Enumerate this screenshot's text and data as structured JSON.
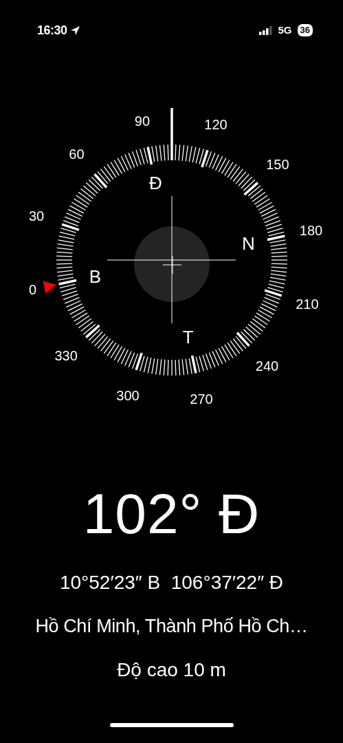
{
  "status_bar": {
    "time": "16:30",
    "network": "5G",
    "battery": "36"
  },
  "compass": {
    "degree_labels": [
      "0",
      "30",
      "60",
      "90",
      "120",
      "150",
      "180",
      "210",
      "240",
      "270",
      "300",
      "330"
    ],
    "cardinal_labels": [
      "B",
      "Đ",
      "N",
      "T"
    ]
  },
  "heading": "102° Đ",
  "coordinates": "10°52′23″ B  106°37′22″ Đ",
  "place": "Hồ Chí Minh, Thành Phố Hồ Ch…",
  "altitude": "Độ cao 10 m"
}
